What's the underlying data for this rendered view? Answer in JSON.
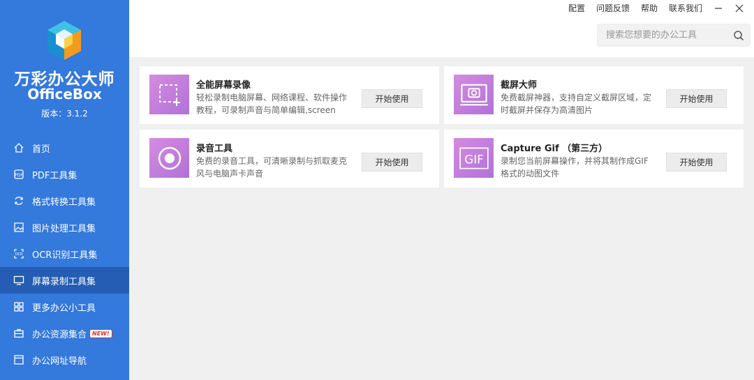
{
  "app": {
    "name_cn": "万彩办公大师",
    "name_en": "OfficeBox",
    "version": "版本：3.1.2"
  },
  "header": {
    "links": [
      "配置",
      "问题反馈",
      "帮助",
      "联系我们"
    ],
    "search_placeholder": "搜索您想要的办公工具"
  },
  "sidebar": {
    "items": [
      {
        "label": "首页",
        "icon": "home-icon"
      },
      {
        "label": "PDF工具集",
        "icon": "pdf-icon"
      },
      {
        "label": "格式转换工具集",
        "icon": "refresh-icon"
      },
      {
        "label": "图片处理工具集",
        "icon": "image-icon"
      },
      {
        "label": "OCR识别工具集",
        "icon": "ocr-icon"
      },
      {
        "label": "屏幕录制工具集",
        "icon": "monitor-icon",
        "active": true
      },
      {
        "label": "更多办公小工具",
        "icon": "grid-icon"
      },
      {
        "label": "办公资源集合",
        "icon": "briefcase-icon",
        "badge": "NEW!"
      },
      {
        "label": "办公网址导航",
        "icon": "browser-icon"
      }
    ]
  },
  "cards": [
    {
      "title": "全能屏幕录像",
      "desc": "轻松录制电脑屏幕、网络课程、软件操作教程，可录制声音与简单编辑,screen",
      "button": "开始使用",
      "icon": "screen-record-icon"
    },
    {
      "title": "截屏大师",
      "desc": "免费截屏神器，支持自定义截屏区域，定时截屏并保存为高清图片",
      "button": "开始使用",
      "icon": "screenshot-icon"
    },
    {
      "title": "录音工具",
      "desc": "免费的录音工具，可清晰录制与抓取麦克风与电脑声卡声音",
      "button": "开始使用",
      "icon": "record-audio-icon"
    },
    {
      "title": "Capture Gif （第三方）",
      "desc": "录制您当前屏幕操作，并将其制作成GIF格式的动图文件",
      "button": "开始使用",
      "icon": "gif-icon"
    }
  ],
  "colors": {
    "sidebar": "#3479dc",
    "sidebar_active": "#245db3",
    "icon_gradient_start": "#d58be0",
    "icon_gradient_end": "#b072d8"
  }
}
